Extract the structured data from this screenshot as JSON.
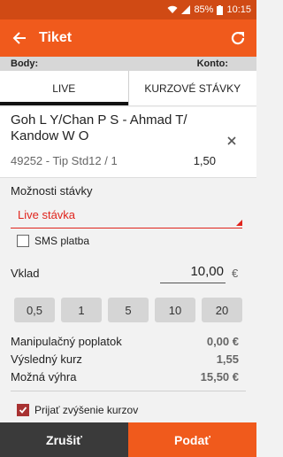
{
  "status_bar": {
    "battery": "85%",
    "time": "10:15"
  },
  "app_bar": {
    "title": "Tiket"
  },
  "info_bar": {
    "body_label": "Body:",
    "konto_label": "Konto:"
  },
  "tabs": [
    {
      "label": "LIVE",
      "active": true
    },
    {
      "label": "KURZOVÉ STÁVKY",
      "active": false
    }
  ],
  "bet": {
    "match": "Goh L Y/Chan P S - Ahmad T/ Kandow W O",
    "tip": "49252 - Tip Std12 / 1",
    "odd": "1,50"
  },
  "options": {
    "label": "Možnosti stávky",
    "selected": "Live stávka",
    "sms_label": "SMS platba",
    "sms_checked": false
  },
  "stake": {
    "label": "Vklad",
    "value": "10,00",
    "currency": "€"
  },
  "quick_stakes": [
    "0,5",
    "1",
    "5",
    "10",
    "20"
  ],
  "summary": [
    {
      "label": "Manipulačný poplatok",
      "value": "0,00 €"
    },
    {
      "label": "Výsledný kurz",
      "value": "1,55"
    },
    {
      "label": "Možná výhra",
      "value": "15,50 €"
    }
  ],
  "accept_increase": {
    "label": "Prijať zvýšenie kurzov",
    "checked": true
  },
  "buttons": {
    "cancel": "Zrušiť",
    "submit": "Podať"
  },
  "colors": {
    "accent": "#f05a1c",
    "status_bar": "#d04a14",
    "select_red": "#e0241c",
    "dark": "#3a3a3a"
  }
}
